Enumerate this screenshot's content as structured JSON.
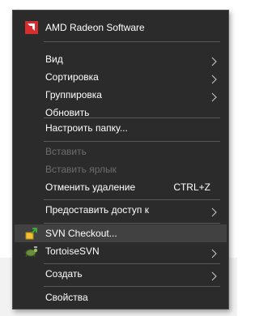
{
  "context_menu": {
    "items": [
      {
        "label": "AMD Radeon Software",
        "icon": "amd-radeon-icon"
      },
      {
        "label": "Вид",
        "submenu": true
      },
      {
        "label": "Сортировка",
        "submenu": true
      },
      {
        "label": "Группировка",
        "submenu": true
      },
      {
        "label": "Обновить"
      },
      {
        "label": "Настроить папку..."
      },
      {
        "label": "Вставить",
        "disabled": true
      },
      {
        "label": "Вставить ярлык",
        "disabled": true
      },
      {
        "label": "Отменить удаление",
        "shortcut": "CTRL+Z"
      },
      {
        "label": "Предоставить доступ к",
        "submenu": true
      },
      {
        "label": "SVN Checkout...",
        "icon": "svn-checkout-icon",
        "highlighted": true
      },
      {
        "label": "TortoiseSVN",
        "icon": "tortoisesvn-icon",
        "submenu": true
      },
      {
        "label": "Создать",
        "submenu": true
      },
      {
        "label": "Свойства"
      }
    ]
  },
  "colors": {
    "menu_background": "#2b2b2b",
    "highlight": "#414141",
    "disabled_text": "#6d6d6d",
    "amd_red": "#d62e2e"
  }
}
